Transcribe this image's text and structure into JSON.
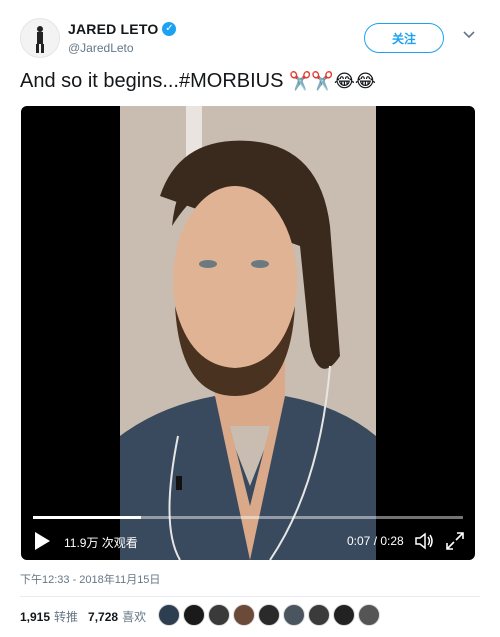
{
  "user": {
    "display_name": "JARED LETO",
    "verified_icon": "verified-badge-icon",
    "handle": "@JaredLeto"
  },
  "follow_button": {
    "label": "关注"
  },
  "tweet": {
    "text": "And so it begins...#MORBIUS",
    "emojis": "✂️✂️😂😂"
  },
  "video": {
    "views": "11.9万 次观看",
    "time": "0:07 / 0:28",
    "progress": 0.25
  },
  "timestamp": "下午12:33 - 2018年11月15日",
  "stats": {
    "retweets_count": "1,915",
    "retweets_label": "转推",
    "likes_count": "7,728",
    "likes_label": "喜欢"
  },
  "likers": [
    "#2c3e50",
    "#1a1a1a",
    "#3a3a3a",
    "#6b4a3a",
    "#2a2a2a",
    "#4a5560",
    "#3b3b3b",
    "#222222",
    "#555555"
  ]
}
